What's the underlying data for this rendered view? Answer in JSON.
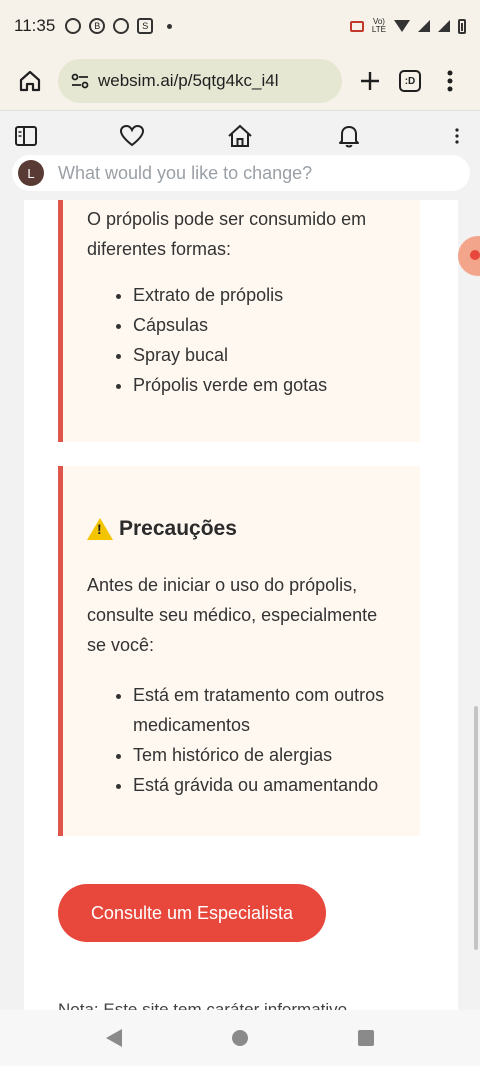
{
  "status_bar": {
    "time": "11:35"
  },
  "browser": {
    "url": "websim.ai/p/5qtg4kc_i4l",
    "tabs_count": ":D"
  },
  "websim": {
    "avatar_letter": "L",
    "prompt_placeholder": "What would you like to change?"
  },
  "forms_card": {
    "intro": "O própolis pode ser consumido em diferentes formas:",
    "items": [
      "Extrato de própolis",
      "Cápsulas",
      "Spray bucal",
      "Própolis verde em gotas"
    ]
  },
  "precautions_card": {
    "title": "Precauções",
    "intro": "Antes de iniciar o uso do própolis, consulte seu médico, especialmente se você:",
    "items": [
      "Está em tratamento com outros medicamentos",
      "Tem histórico de alergias",
      "Está grávida ou amamentando"
    ]
  },
  "cta_label": "Consulte um Especialista",
  "note_text": "Nota: Este site tem caráter informativo",
  "colors": {
    "accent": "#e8483c",
    "card_bg": "#fff8f1"
  }
}
